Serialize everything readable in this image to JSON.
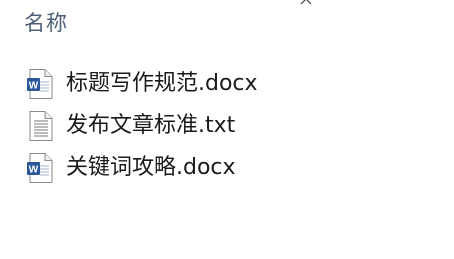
{
  "header": {
    "name_column": "名称"
  },
  "files": [
    {
      "name": "标题写作规范.docx",
      "icon": "word-document-icon"
    },
    {
      "name": "发布文章标准.txt",
      "icon": "text-document-icon"
    },
    {
      "name": "关键词攻略.docx",
      "icon": "word-document-icon"
    }
  ],
  "colors": {
    "header_text": "#4c607a",
    "file_text": "#1b1b1b",
    "word_blue": "#2b579a",
    "background": "#ffffff"
  }
}
